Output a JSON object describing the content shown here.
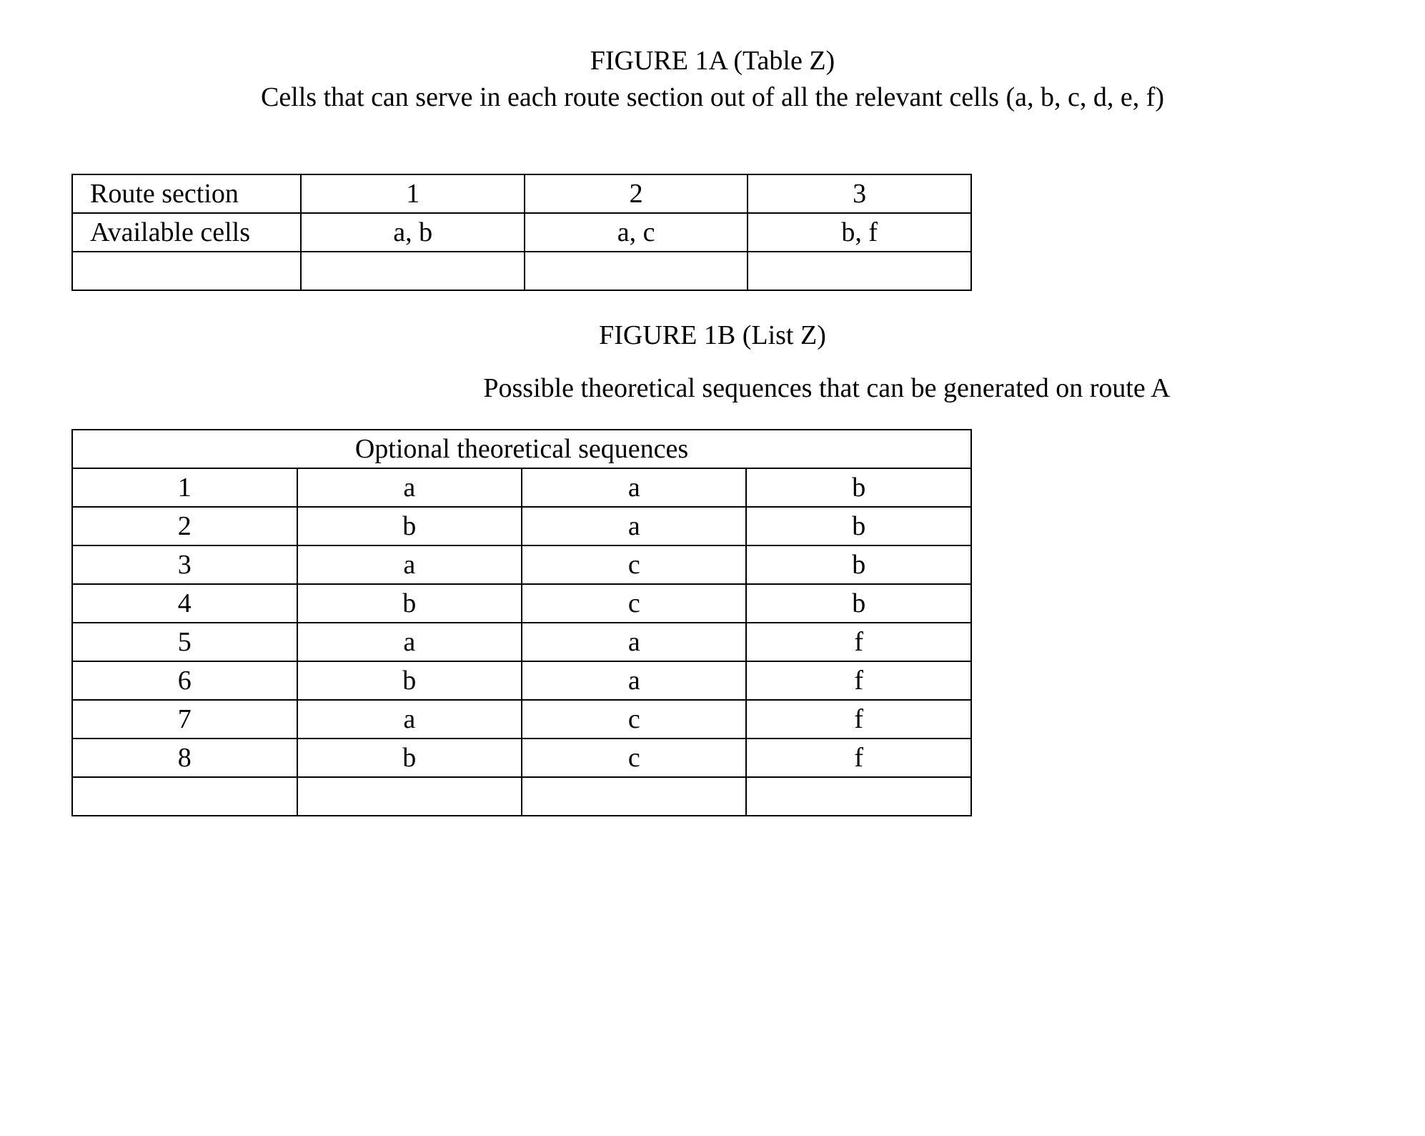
{
  "figureA": {
    "title": "FIGURE 1A  (Table Z)",
    "subtitle": "Cells that can serve in each route section out of all the relevant cells (a, b, c, d, e, f)",
    "table": {
      "row1": {
        "label": "Route section",
        "c1": "1",
        "c2": "2",
        "c3": "3"
      },
      "row2": {
        "label": "Available cells",
        "c1": "a, b",
        "c2": "a, c",
        "c3": "b, f"
      },
      "row3": {
        "label": "",
        "c1": "",
        "c2": "",
        "c3": ""
      }
    }
  },
  "figureB": {
    "title": "FIGURE 1B  (List Z)",
    "subtitle": "Possible theoretical sequences that can be generated on route A",
    "header": "Optional theoretical sequences",
    "rows": {
      "r1": {
        "n": "1",
        "c1": "a",
        "c2": "a",
        "c3": "b"
      },
      "r2": {
        "n": "2",
        "c1": "b",
        "c2": "a",
        "c3": "b"
      },
      "r3": {
        "n": "3",
        "c1": "a",
        "c2": "c",
        "c3": "b"
      },
      "r4": {
        "n": "4",
        "c1": "b",
        "c2": "c",
        "c3": "b"
      },
      "r5": {
        "n": "5",
        "c1": "a",
        "c2": "a",
        "c3": "f"
      },
      "r6": {
        "n": "6",
        "c1": "b",
        "c2": "a",
        "c3": "f"
      },
      "r7": {
        "n": "7",
        "c1": "a",
        "c2": "c",
        "c3": "f"
      },
      "r8": {
        "n": "8",
        "c1": "b",
        "c2": "c",
        "c3": "f"
      },
      "r9": {
        "n": "",
        "c1": "",
        "c2": "",
        "c3": ""
      }
    }
  }
}
